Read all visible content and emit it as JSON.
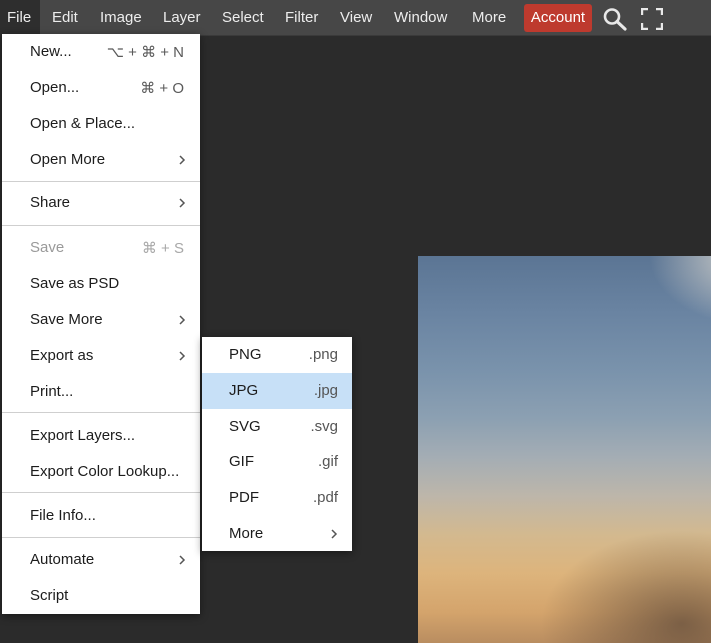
{
  "menubar": {
    "items": [
      "File",
      "Edit",
      "Image",
      "Layer",
      "Select",
      "Filter",
      "View",
      "Window",
      "More"
    ],
    "account_label": "Account"
  },
  "file_menu": {
    "new": {
      "label": "New...",
      "shortcut": "⌥ + ⌘ + N"
    },
    "open": {
      "label": "Open...",
      "shortcut": "⌘ + O"
    },
    "open_place": {
      "label": "Open & Place..."
    },
    "open_more": {
      "label": "Open More"
    },
    "share": {
      "label": "Share"
    },
    "save": {
      "label": "Save",
      "shortcut": "⌘ + S",
      "disabled": true
    },
    "save_psd": {
      "label": "Save as PSD"
    },
    "save_more": {
      "label": "Save More"
    },
    "export_as": {
      "label": "Export as"
    },
    "print": {
      "label": "Print..."
    },
    "export_layers": {
      "label": "Export Layers..."
    },
    "export_color_lookup": {
      "label": "Export Color Lookup..."
    },
    "file_info": {
      "label": "File Info..."
    },
    "automate": {
      "label": "Automate"
    },
    "script": {
      "label": "Script"
    }
  },
  "export_menu": {
    "items": [
      {
        "label": "PNG",
        "ext": ".png"
      },
      {
        "label": "JPG",
        "ext": ".jpg"
      },
      {
        "label": "SVG",
        "ext": ".svg"
      },
      {
        "label": "GIF",
        "ext": ".gif"
      },
      {
        "label": "PDF",
        "ext": ".pdf"
      },
      {
        "label": "More",
        "ext": ""
      }
    ],
    "highlighted_index": 1
  },
  "colors": {
    "menubar_bg": "#474747",
    "account_bg": "#be3a2e",
    "workspace_bg": "#2b2b2b",
    "highlight": "#c7e0f7"
  },
  "icons": {
    "search": "search-icon",
    "fullscreen": "fullscreen-icon",
    "submenu_arrow": "chevron-right-icon"
  }
}
